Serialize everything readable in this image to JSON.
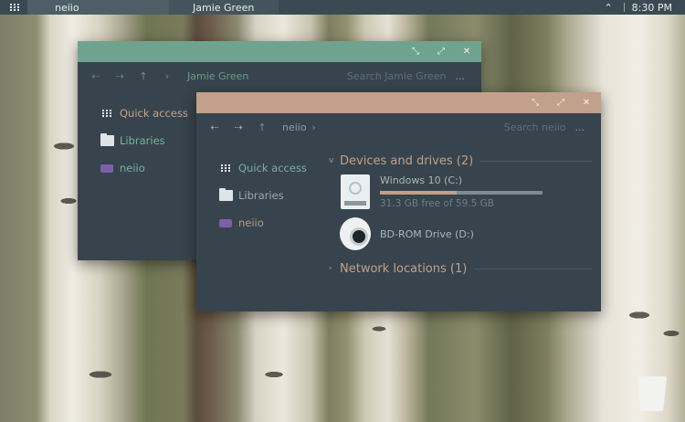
{
  "taskbar": {
    "tasks": [
      {
        "label": "neiio"
      },
      {
        "label": "Jamie Green"
      }
    ],
    "clock": "8:30 PM"
  },
  "window_back": {
    "path": "Jamie Green",
    "search_placeholder": "Search Jamie Green",
    "more": "...",
    "sidebar": [
      {
        "label": "Quick access"
      },
      {
        "label": "Libraries"
      },
      {
        "label": "neiio"
      }
    ]
  },
  "window_front": {
    "path": "neiio",
    "search_placeholder": "Search neiio",
    "more": "...",
    "sidebar": [
      {
        "label": "Quick access"
      },
      {
        "label": "Libraries"
      },
      {
        "label": "neiio"
      }
    ],
    "groups": {
      "devices": {
        "label": "Devices and drives (2)"
      },
      "network": {
        "label": "Network locations (1)"
      }
    },
    "drives": [
      {
        "name": "Windows 10 (C:)",
        "free_text": "31.3 GB free of 59.5 GB",
        "used_fraction": 0.47
      },
      {
        "name": "BD-ROM Drive (D:)"
      }
    ]
  },
  "colors": {
    "accent_green": "#6fa38f",
    "accent_tan": "#c2a08b",
    "window_bg": "#37444d",
    "taskbar_bg": "#3b4a52"
  }
}
